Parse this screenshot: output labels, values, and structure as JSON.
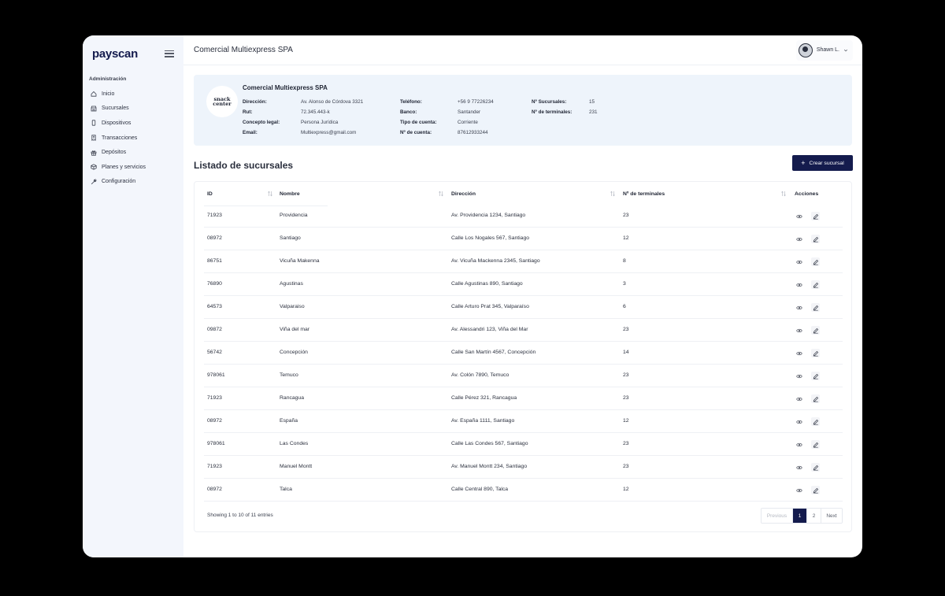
{
  "brand": {
    "logo_text": "payscan",
    "accent": "#141b4d"
  },
  "sidebar": {
    "section": "Administración",
    "items": [
      {
        "label": "Inicio",
        "icon": "home-icon"
      },
      {
        "label": "Sucursales",
        "icon": "store-icon"
      },
      {
        "label": "Dispositivos",
        "icon": "device-icon"
      },
      {
        "label": "Transacciones",
        "icon": "receipt-icon"
      },
      {
        "label": "Depósitos",
        "icon": "gift-icon"
      },
      {
        "label": "Planes y servicios",
        "icon": "box-icon"
      },
      {
        "label": "Configuración",
        "icon": "wrench-icon"
      }
    ]
  },
  "header": {
    "title": "Comercial Multiexpress SPA",
    "user_name": "Shawn L."
  },
  "company": {
    "logo_line1": "snack",
    "logo_line2": "center",
    "name": "Comercial Multiexpress SPA",
    "fields": {
      "direccion": {
        "label": "Dirección:",
        "value": "Av. Alonso de Córdova 3321"
      },
      "rut": {
        "label": "Rut:",
        "value": "72.345.443-k"
      },
      "concepto": {
        "label": "Concepto legal:",
        "value": "Persona Jurídica"
      },
      "email": {
        "label": "Email:",
        "value": "Multiexpress@gmail.com"
      },
      "telefono": {
        "label": "Teléfono:",
        "value": "+56 9 77226234"
      },
      "banco": {
        "label": "Banco:",
        "value": "Santander"
      },
      "tipo_cuenta": {
        "label": "Tipo de cuenta:",
        "value": "Corriente"
      },
      "num_cuenta": {
        "label": "Nº de cuenta:",
        "value": "87612933244"
      },
      "sucursales": {
        "label": "Nº Sucursales:",
        "value": "15"
      },
      "terminales": {
        "label": "Nº de terminales:",
        "value": "231"
      }
    }
  },
  "list": {
    "title": "Listado de sucursales",
    "create_label": "Crear sucursal"
  },
  "table": {
    "headers": {
      "id": "ID",
      "nombre": "Nombre",
      "direccion": "Dirección",
      "terminales": "Nº de terminales",
      "acciones": "Acciones"
    },
    "rows": [
      {
        "id": "71923",
        "nombre": "Providencia",
        "direccion": "Av. Providencia 1234, Santiago",
        "terminales": "23"
      },
      {
        "id": "08972",
        "nombre": "Santiago",
        "direccion": "Calle Los Nogales 567, Santiago",
        "terminales": "12"
      },
      {
        "id": "86751",
        "nombre": "Vicuña Makenna",
        "direccion": "Av. Vicuña Mackenna 2345, Santiago",
        "terminales": "8"
      },
      {
        "id": "76890",
        "nombre": "Agustinas",
        "direccion": "Calle Agustinas 890, Santiago",
        "terminales": "3"
      },
      {
        "id": "64573",
        "nombre": "Valparaiso",
        "direccion": "Calle Arturo Prat 345, Valparaíso",
        "terminales": "6"
      },
      {
        "id": "09872",
        "nombre": "Viña del mar",
        "direccion": "Av. Alessandri 123, Viña del Mar",
        "terminales": "23"
      },
      {
        "id": "56742",
        "nombre": "Concepción",
        "direccion": "Calle San Martín 4567, Concepción",
        "terminales": "14"
      },
      {
        "id": "978061",
        "nombre": "Temuco",
        "direccion": "Av. Colón 7890, Temuco",
        "terminales": "23"
      },
      {
        "id": "71923",
        "nombre": "Rancagua",
        "direccion": "Calle Pérez 321, Rancagua",
        "terminales": "23"
      },
      {
        "id": "08972",
        "nombre": "España",
        "direccion": "Av. España 1111, Santiago",
        "terminales": "12"
      },
      {
        "id": "978061",
        "nombre": "Las Condes",
        "direccion": "Calle Las Condes 567, Santiago",
        "terminales": "23"
      },
      {
        "id": "71923",
        "nombre": "Manuel Montt",
        "direccion": "Av. Manuel Montt 234, Santiago",
        "terminales": "23"
      },
      {
        "id": "08972",
        "nombre": "Talca",
        "direccion": "Calle Central 890, Talca",
        "terminales": "12"
      }
    ],
    "footer": "Showing 1 to 10 of 11 entries",
    "pagination": {
      "prev": "Previous",
      "pages": [
        "1",
        "2"
      ],
      "active": "1",
      "next": "Next"
    }
  }
}
